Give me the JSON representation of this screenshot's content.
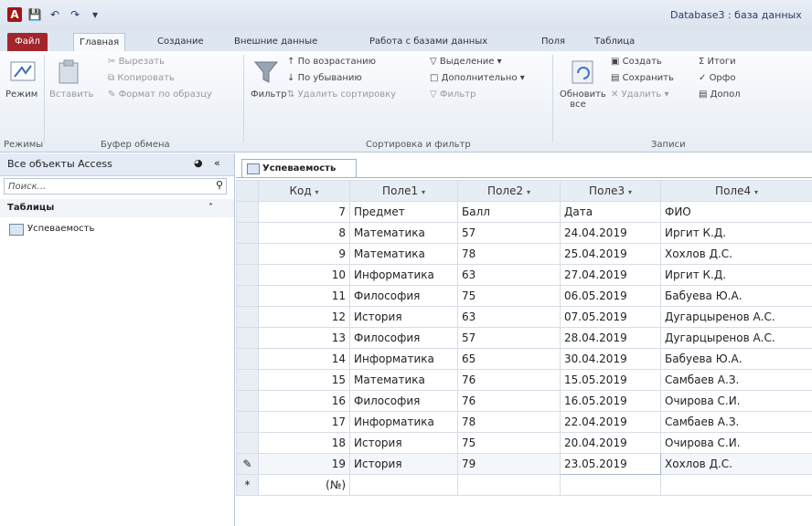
{
  "window": {
    "title": "Database3 : база данных"
  },
  "qat": {
    "app_icon": "A",
    "save_icon": "save-icon",
    "undo_icon": "undo-icon",
    "redo_icon": "redo-icon"
  },
  "ribbon_tabs": [
    "Файл",
    "Главная",
    "Создание",
    "Внешние данные",
    "Работа с базами данных",
    "Поля",
    "Таблица"
  ],
  "ribbon": {
    "views": {
      "view_label": "Режим",
      "group": "Режимы"
    },
    "clipboard": {
      "paste": "Вставить",
      "cut": "Вырезать",
      "copy": "Копировать",
      "format_painter": "Формат по образцу",
      "group": "Буфер обмена"
    },
    "sort_filter": {
      "filter": "Фильтр",
      "ascending": "По возрастанию",
      "descending": "По убыванию",
      "remove_sort": "Удалить сортировку",
      "selection": "Выделение",
      "advanced": "Дополнительно",
      "toggle_filter": "Фильтр",
      "group": "Сортировка и фильтр"
    },
    "records": {
      "refresh": "Обновить все",
      "new": "Создать",
      "save": "Сохранить",
      "delete": "Удалить",
      "totals": "Итоги",
      "spelling": "Орфо",
      "more": "Допол",
      "group": "Записи"
    }
  },
  "nav": {
    "header": "Все объекты Access",
    "search_placeholder": "Поиск...",
    "group": "Таблицы",
    "items": [
      "Успеваемость"
    ]
  },
  "document": {
    "tab": "Успеваемость"
  },
  "table": {
    "columns": [
      "Код",
      "Поле1",
      "Поле2",
      "Поле3",
      "Поле4"
    ],
    "rows": [
      [
        "7",
        "Предмет",
        "Балл",
        "Дата",
        "ФИО"
      ],
      [
        "8",
        "Математика",
        "57",
        "24.04.2019",
        "Иргит К.Д."
      ],
      [
        "9",
        "Математика",
        "78",
        "25.04.2019",
        "Хохлов Д.С."
      ],
      [
        "10",
        "Информатика",
        "63",
        "27.04.2019",
        "Иргит К.Д."
      ],
      [
        "11",
        "Философия",
        "75",
        "06.05.2019",
        "Бабуева Ю.А."
      ],
      [
        "12",
        "История",
        "63",
        "07.05.2019",
        "Дугарцыренов А.С."
      ],
      [
        "13",
        "Философия",
        "57",
        "28.04.2019",
        "Дугарцыренов А.С."
      ],
      [
        "14",
        "Информатика",
        "65",
        "30.04.2019",
        "Бабуева Ю.А."
      ],
      [
        "15",
        "Математика",
        "76",
        "15.05.2019",
        "Самбаев А.З."
      ],
      [
        "16",
        "Философия",
        "76",
        "16.05.2019",
        "Очирова С.И."
      ],
      [
        "17",
        "Информатика",
        "78",
        "22.04.2019",
        "Самбаев А.З."
      ],
      [
        "18",
        "История",
        "75",
        "20.04.2019",
        "Очирова С.И."
      ],
      [
        "19",
        "История",
        "79",
        "23.05.2019",
        "Хохлов Д.С."
      ]
    ],
    "new_row_marker": "(№)",
    "edit_marker": "✎",
    "new_marker": "*"
  }
}
